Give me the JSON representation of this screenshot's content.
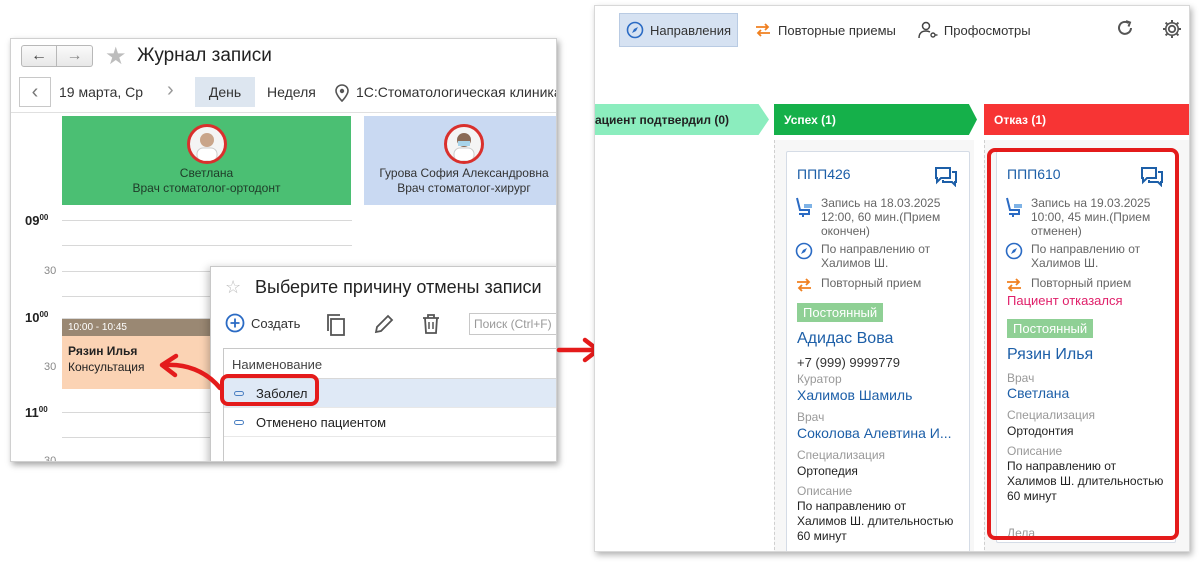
{
  "left": {
    "title": "Журнал записи",
    "date": "19 марта, Ср",
    "view_day": "День",
    "view_week": "Неделя",
    "clinic": "1С:Стоматологическая клиника",
    "doctors": [
      {
        "name": "Светлана",
        "spec": "Врач стоматолог-ортодонт"
      },
      {
        "name": "Гурова София Александровна",
        "spec": "Врач стоматолог-хирург"
      }
    ],
    "times": {
      "t9": "09",
      "t10": "10",
      "t11": "11",
      "min00": "00",
      "half": "30"
    },
    "appointment": {
      "time": "10:00 - 10:45",
      "patient": "Рязин Илья",
      "type": "Консультация"
    }
  },
  "dialog": {
    "title": "Выберите причину отмены записи",
    "create": "Создать",
    "search_placeholder": "Поиск (Ctrl+F)",
    "column": "Наименование",
    "rows": [
      "Заболел",
      "Отменено пациентом"
    ]
  },
  "right": {
    "tabs": [
      "Направления",
      "Повторные приемы",
      "Профосмотры"
    ],
    "stages": {
      "confirmed": "ациент подтвердил (0)",
      "success": "Успех (1)",
      "fail": "Отказ (1)"
    },
    "card1": {
      "id": "ППП426",
      "record": "Запись на 18.03.2025 12:00, 60 мин.(Прием окончен)",
      "record_l1": "Запись на 18.03.2025",
      "record_l2": "12:00, 60 мин.(Прием",
      "record_l3": "окончен)",
      "referral_l1": "По направлению от",
      "referral_l2": "Халимов Ш.",
      "repeat": "Повторный прием",
      "badge": "Постоянный",
      "patient": "Адидас Вова",
      "phone": "+7 (999) 9999779",
      "curator_label": "Куратор",
      "curator": "Халимов Шамиль",
      "doctor_label": "Врач",
      "doctor": "Соколова Алевтина И...",
      "spec_label": "Специализация",
      "spec": "Ортопедия",
      "desc_label": "Описание",
      "desc_l1": "По направлению от",
      "desc_l2": "Халимов Ш. длительностью",
      "desc_l3": "60 минут"
    },
    "card2": {
      "id": "ППП610",
      "record_l1": "Запись на 19.03.2025",
      "record_l2": "10:00, 45 мин.(Прием",
      "record_l3": "отменен)",
      "referral_l1": "По направлению от",
      "referral_l2": "Халимов Ш.",
      "repeat": "Повторный прием",
      "refused": "Пациент отказался",
      "badge": "Постоянный",
      "patient": "Рязин Илья",
      "doctor_label": "Врач",
      "doctor": "Светлана",
      "spec_label": "Специализация",
      "spec": "Ортодонтия",
      "desc_label": "Описание",
      "desc_l1": "По направлению от",
      "desc_l2": "Халимов Ш. длительностью",
      "desc_l3": "60 минут",
      "extra": "Дела"
    }
  },
  "colors": {
    "accent_red": "#e41b1b",
    "success": "#15b04a",
    "fail": "#f73434",
    "link": "#1d5fa8"
  }
}
